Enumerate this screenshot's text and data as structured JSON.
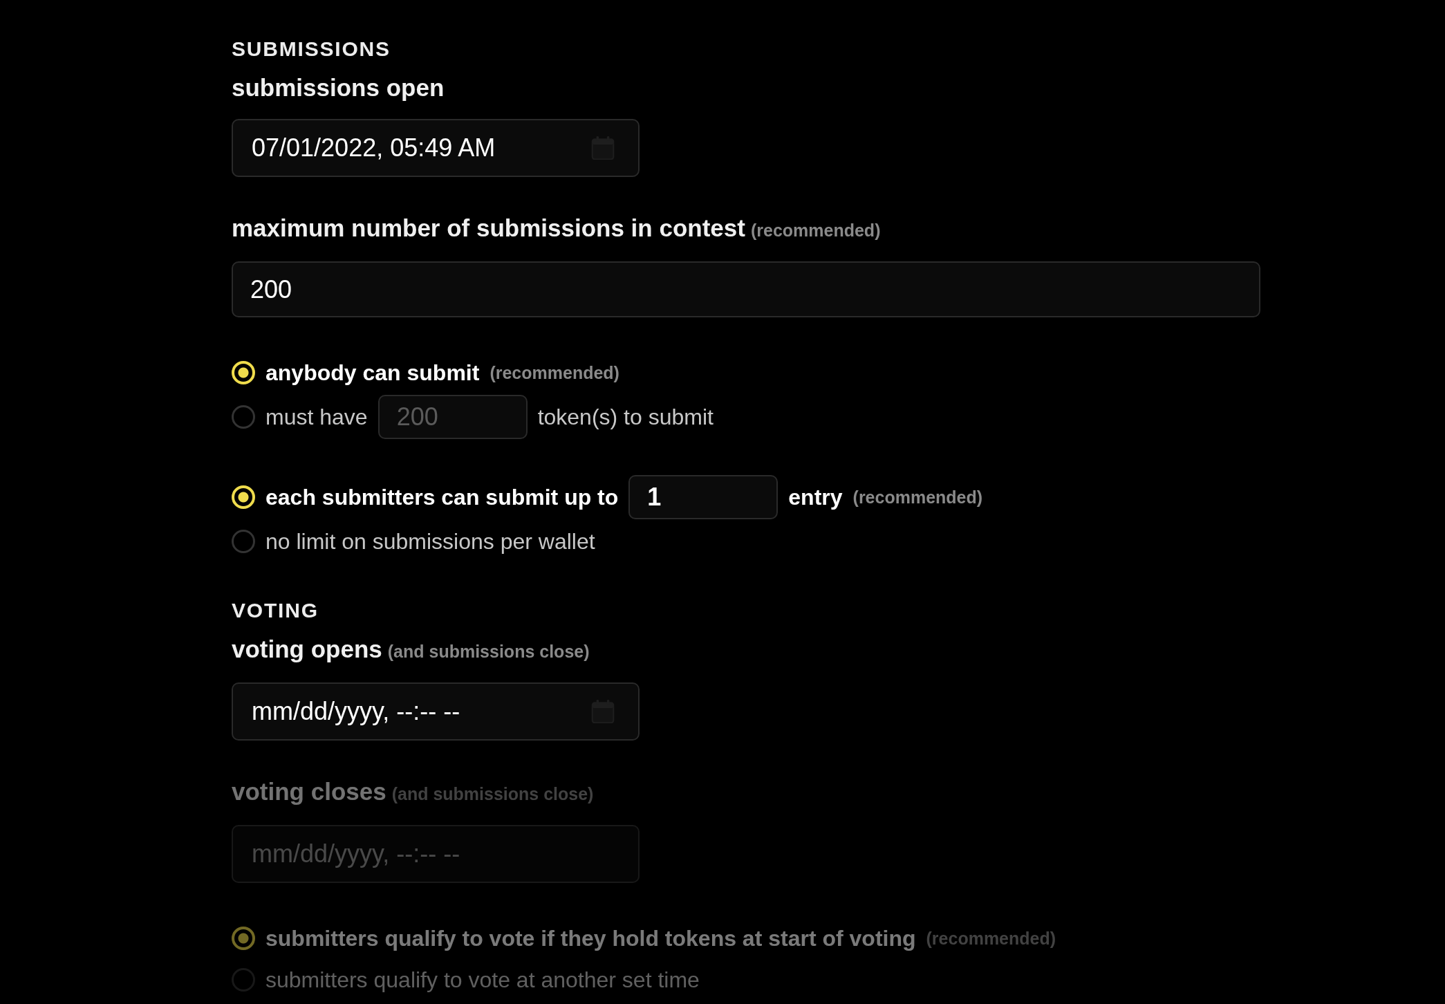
{
  "sections": [
    {
      "heading": "SUBMISSIONS",
      "items": [
        {
          "kind": "datetime",
          "label": "submissions open",
          "value": "07/01/2022, 05:49 AM",
          "disabled": false
        },
        {
          "kind": "number",
          "label": "maximum number of submissions in contest",
          "note": "(recommended)",
          "value": "200",
          "disabled": false
        },
        {
          "kind": "radios",
          "disabled": false,
          "options": [
            {
              "selected": true,
              "parts": [
                {
                  "kind": "text",
                  "text": "anybody can submit"
                },
                {
                  "kind": "note",
                  "text": "(recommended)"
                }
              ]
            },
            {
              "selected": false,
              "parts": [
                {
                  "kind": "text",
                  "text": "must have"
                },
                {
                  "kind": "input",
                  "placeholder": "200"
                },
                {
                  "kind": "text",
                  "text": "token(s) to submit"
                }
              ]
            }
          ]
        },
        {
          "kind": "radios",
          "disabled": false,
          "options": [
            {
              "selected": true,
              "parts": [
                {
                  "kind": "text",
                  "text": "each submitters can submit up to"
                },
                {
                  "kind": "input",
                  "value": "1"
                },
                {
                  "kind": "text",
                  "text": "entry"
                },
                {
                  "kind": "note",
                  "text": "(recommended)"
                }
              ]
            },
            {
              "selected": false,
              "parts": [
                {
                  "kind": "text",
                  "text": "no limit on submissions per wallet"
                }
              ]
            }
          ]
        }
      ]
    },
    {
      "heading": "VOTING",
      "items": [
        {
          "kind": "datetime",
          "label": "voting opens",
          "note": "(and submissions close)",
          "placeholder": "mm/dd/yyyy, --:-- --",
          "disabled": false
        },
        {
          "kind": "datetime",
          "label": "voting closes",
          "note": "(and submissions close)",
          "placeholder": "mm/dd/yyyy, --:-- --",
          "disabled": true
        },
        {
          "kind": "radios",
          "disabled": true,
          "options": [
            {
              "selected": true,
              "parts": [
                {
                  "kind": "text",
                  "text": "submitters qualify to vote if they hold tokens at start of voting"
                },
                {
                  "kind": "note",
                  "text": "(recommended)"
                }
              ]
            },
            {
              "selected": false,
              "parts": [
                {
                  "kind": "text",
                  "text": "submitters qualify to vote at another set time"
                }
              ]
            }
          ]
        }
      ]
    }
  ]
}
